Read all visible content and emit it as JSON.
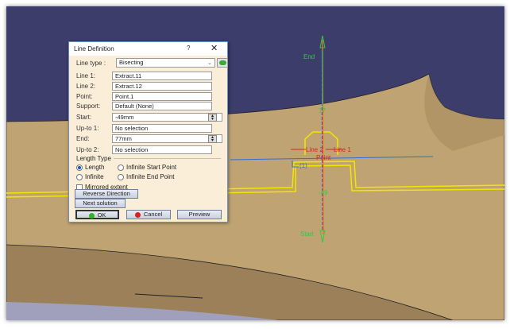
{
  "dialog": {
    "title": "Line Definition",
    "help": "?",
    "close": "✕",
    "line_type_label": "Line type :",
    "line_type_value": "Bisecting",
    "fields": [
      {
        "label": "Line 1:",
        "value": "Extract.11"
      },
      {
        "label": "Line 2:",
        "value": "Extract.12"
      },
      {
        "label": "Point:",
        "value": "Point.1"
      },
      {
        "label": "Support:",
        "value": "Default (None)"
      },
      {
        "label": "Start:",
        "value": "-49mm"
      },
      {
        "label": "Up-to 1:",
        "value": "No selection"
      },
      {
        "label": "End:",
        "value": "77mm"
      },
      {
        "label": "Up-to 2:",
        "value": "No selection"
      }
    ],
    "length_type_label": "Length Type",
    "radios": [
      {
        "label": "Length",
        "checked": true
      },
      {
        "label": "Infinite Start Point",
        "checked": false
      },
      {
        "label": "Infinite",
        "checked": false
      },
      {
        "label": "Infinite End Point",
        "checked": false
      }
    ],
    "mirrored_label": "Mirrored extent",
    "mirrored_checked": false,
    "reverse_label": "Reverse Direction",
    "next_label": "Next solution",
    "ok_label": "OK",
    "cancel_label": "Cancel",
    "preview_label": "Preview"
  },
  "viewport": {
    "end_label": "End",
    "start_label": "Start",
    "line1_label": "Line 1",
    "line2_label": "Line 2",
    "point_label": "Point",
    "end_value": "77",
    "start_value": "-49",
    "corner_label": "(1)",
    "colors": {
      "sky": "#3c3d6b",
      "surface": "#c3a574",
      "highlight": "#f2e600",
      "green": "#2ecc40",
      "red": "#e02020",
      "blue": "#2f6fd6"
    }
  }
}
